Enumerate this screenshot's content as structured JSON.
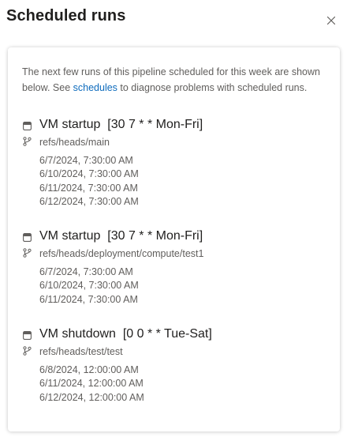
{
  "header": {
    "title": "Scheduled runs",
    "close_icon": "close-icon"
  },
  "intro": {
    "text_before": "The next few runs of this pipeline scheduled for this week are shown below. See ",
    "link_text": "schedules",
    "text_after": " to diagnose problems with scheduled runs."
  },
  "schedules": [
    {
      "name": "VM startup  [30 7 * * Mon-Fri]",
      "branch": "refs/heads/main",
      "runs": [
        "6/7/2024, 7:30:00 AM",
        "6/10/2024, 7:30:00 AM",
        "6/11/2024, 7:30:00 AM",
        "6/12/2024, 7:30:00 AM"
      ]
    },
    {
      "name": "VM startup  [30 7 * * Mon-Fri]",
      "branch": "refs/heads/deployment/compute/test1",
      "runs": [
        "6/7/2024, 7:30:00 AM",
        "6/10/2024, 7:30:00 AM",
        "6/11/2024, 7:30:00 AM"
      ]
    },
    {
      "name": "VM shutdown  [0 0 * * Tue-Sat]",
      "branch": "refs/heads/test/test",
      "runs": [
        "6/8/2024, 12:00:00 AM",
        "6/11/2024, 12:00:00 AM",
        "6/12/2024, 12:00:00 AM"
      ]
    }
  ],
  "icons": {
    "schedule": "schedule-icon",
    "branch": "branch-icon"
  },
  "colors": {
    "link": "#0f6cbd",
    "text_primary": "#201f1e",
    "text_secondary": "#605e5c"
  }
}
